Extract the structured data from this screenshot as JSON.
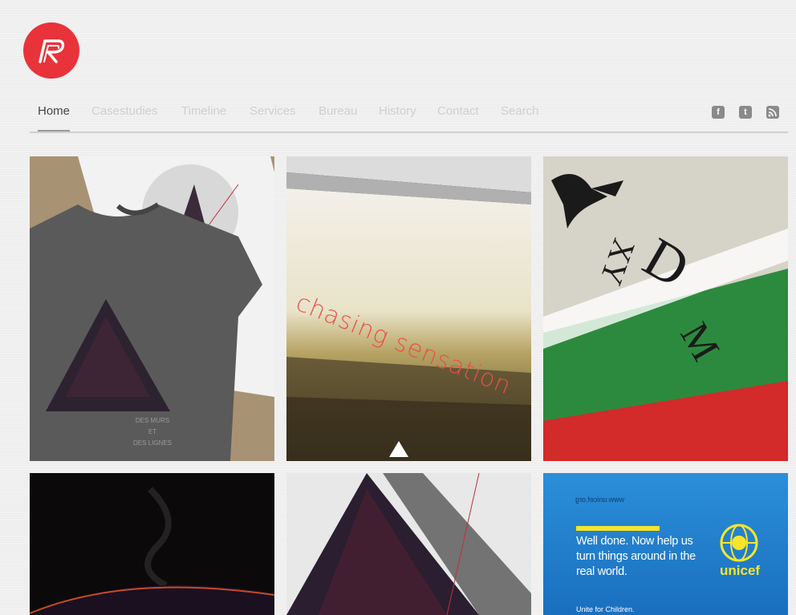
{
  "brand": {
    "logo_color": "#e8333b"
  },
  "nav": {
    "items": [
      {
        "label": "Home",
        "active": true
      },
      {
        "label": "Casestudies",
        "active": false
      },
      {
        "label": "Timeline",
        "active": false
      },
      {
        "label": "Services",
        "active": false
      },
      {
        "label": "Bureau",
        "active": false
      },
      {
        "label": "History",
        "active": false
      },
      {
        "label": "Contact",
        "active": false
      },
      {
        "label": "Search",
        "active": false
      }
    ],
    "social": [
      {
        "icon": "facebook-icon",
        "glyph": "f"
      },
      {
        "icon": "twitter-icon",
        "glyph": "t"
      },
      {
        "icon": "rss-icon",
        "glyph": ""
      }
    ]
  },
  "portfolio": {
    "tshirt": {
      "line1": "DES MURS",
      "line2": "ET",
      "line3": "DES LIGNES"
    },
    "chasing": {
      "title": "chasing sensation"
    },
    "unicef": {
      "url": "www.unicef.org",
      "message": "Well done. Now help us turn things around in the real world.",
      "tagline": "Unite for Children.",
      "logo": "unicef"
    }
  }
}
